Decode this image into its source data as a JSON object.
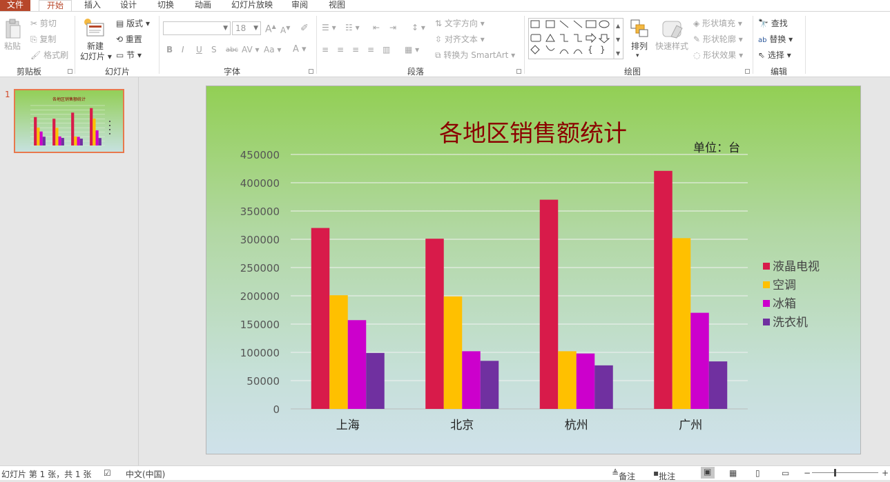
{
  "tabs": {
    "file": "文件",
    "items": [
      "开始",
      "插入",
      "设计",
      "切换",
      "动画",
      "幻灯片放映",
      "审阅",
      "视图"
    ],
    "active": "开始"
  },
  "ribbon": {
    "clipboard": {
      "paste": "粘贴",
      "cut": "剪切",
      "copy": "复制",
      "format_painter": "格式刷",
      "group": "剪贴板"
    },
    "slides": {
      "new_slide_line1": "新建",
      "new_slide_line2": "幻灯片",
      "layout": "版式",
      "reset": "重置",
      "section": "节",
      "group": "幻灯片"
    },
    "font": {
      "font_name": "",
      "font_size": "18",
      "bold": "B",
      "italic": "I",
      "underline": "U",
      "shadow": "S",
      "strike": "abc",
      "spacing": "AV",
      "case": "Aa",
      "color": "A",
      "grow": "A",
      "shrink": "A",
      "group": "字体"
    },
    "paragraph": {
      "text_direction": "文字方向",
      "align_text": "对齐文本",
      "smartart": "转换为 SmartArt",
      "group": "段落"
    },
    "drawing": {
      "arrange": "排列",
      "quick_styles": "快速样式",
      "shape_fill": "形状填充",
      "shape_outline": "形状轮廓",
      "shape_effects": "形状效果",
      "group": "绘图"
    },
    "editing": {
      "find": "查找",
      "replace": "替换",
      "select": "选择",
      "group": "编辑"
    }
  },
  "slide_panel": {
    "slide_number": "1"
  },
  "chart_data": {
    "type": "bar",
    "title": "各地区销售额统计",
    "unit_label": "单位：台",
    "categories": [
      "上海",
      "北京",
      "杭州",
      "广州"
    ],
    "series": [
      {
        "name": "液晶电视",
        "color": "#d81b4a",
        "values": [
          320000,
          301000,
          370000,
          421000
        ]
      },
      {
        "name": "空调",
        "color": "#ffc000",
        "values": [
          201000,
          199000,
          102000,
          302000
        ]
      },
      {
        "name": "冰箱",
        "color": "#cc00cc",
        "values": [
          157000,
          102000,
          98000,
          170000
        ]
      },
      {
        "name": "洗衣机",
        "color": "#7030a0",
        "values": [
          99000,
          85000,
          77000,
          84000
        ]
      }
    ],
    "ylim": [
      0,
      450000
    ],
    "yticks": [
      "0",
      "50000",
      "100000",
      "150000",
      "200000",
      "250000",
      "300000",
      "350000",
      "400000",
      "450000"
    ],
    "grid": true,
    "legend_position": "right"
  },
  "status": {
    "slide_info": "幻灯片 第 1 张，共 1 张",
    "language": "中文(中国)",
    "notes": "备注",
    "comments": "批注"
  }
}
